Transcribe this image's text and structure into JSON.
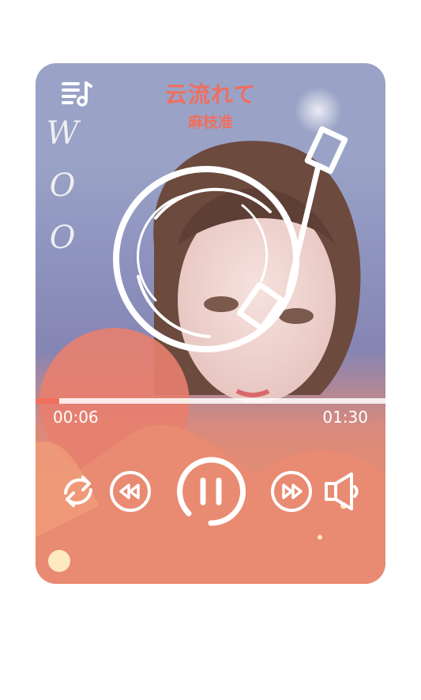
{
  "song": {
    "title": "云流れて",
    "artist": "麻枝准"
  },
  "decoration": {
    "letters": [
      "W",
      "O",
      "O"
    ]
  },
  "playback": {
    "current_time": "00:06",
    "total_time": "01:30",
    "progress_fraction": 0.067,
    "state": "playing"
  },
  "controls": {
    "icons": [
      "playlist-icon",
      "repeat-icon",
      "rewind-icon",
      "pause-icon",
      "fast-forward-icon",
      "volume-icon"
    ]
  },
  "colors": {
    "accent": "#f06e5e",
    "icon": "#ffffff"
  }
}
